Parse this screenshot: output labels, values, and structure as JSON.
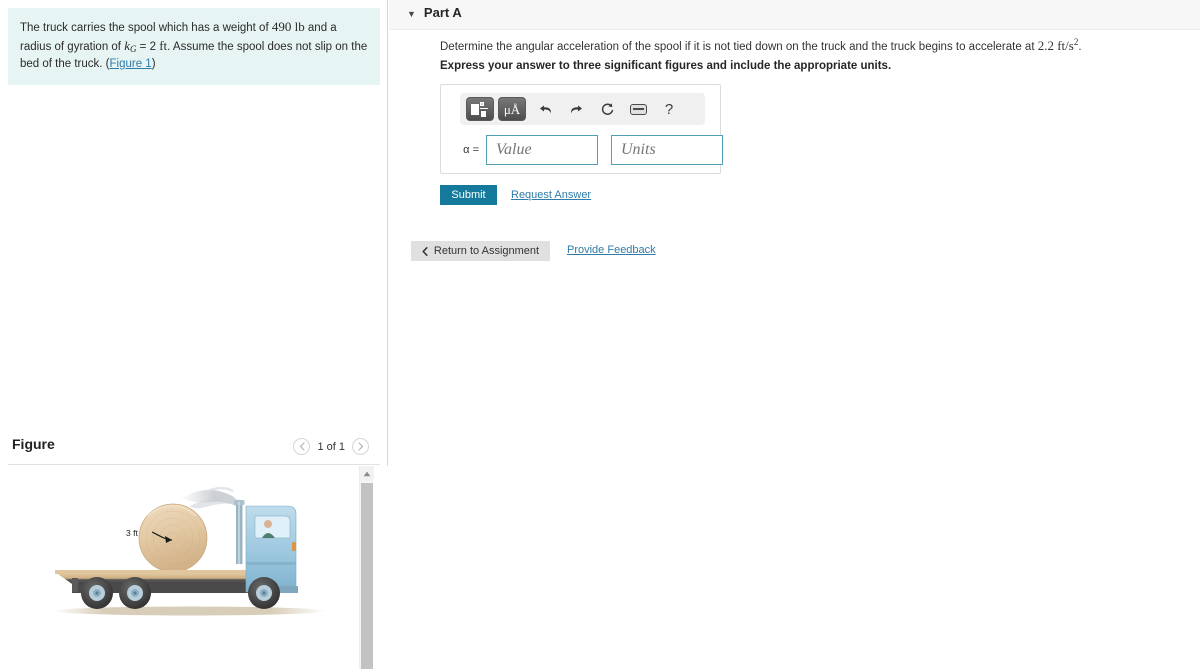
{
  "problem": {
    "text_1": "The truck carries the spool which has a weight of ",
    "weight": "490",
    "weight_unit": "lb",
    "text_2": " and a radius of gyration of ",
    "kg_symbol": "k",
    "kg_sub": "G",
    "kg_eq": " = 2 ",
    "kg_unit": "ft",
    "text_3": ". Assume the spool does not slip on the bed of the truck. (",
    "figure_link": "Figure 1",
    "text_4": ")"
  },
  "figure": {
    "title": "Figure",
    "pager_label": "1 of 1",
    "prev_icon": "chevron-left-icon",
    "next_icon": "chevron-right-icon",
    "radius_label": "3 ft",
    "scroll_up_icon": "caret-up-icon"
  },
  "part": {
    "caret_icon": "caret-down-icon",
    "title": "Part A",
    "question_pre": "Determine the angular acceleration of the spool if it is not tied down on the truck and the truck begins to accelerate at ",
    "question_value": "2.2",
    "question_unit": "ft/s",
    "question_exp": "2",
    "question_post": ".",
    "express": "Express your answer to three significant figures and include the appropriate units."
  },
  "answer": {
    "variable": "α =",
    "value_placeholder": "Value",
    "units_placeholder": "Units",
    "toolbar": {
      "template_icon": "math-template-icon",
      "units_label": "μÅ",
      "undo_icon": "undo-icon",
      "redo_icon": "redo-icon",
      "reset_icon": "reset-icon",
      "keyboard_icon": "keyboard-icon",
      "help_label": "?"
    }
  },
  "actions": {
    "submit_label": "Submit",
    "request_answer_label": "Request Answer",
    "return_label": "Return to Assignment",
    "return_icon": "chevron-left-icon",
    "feedback_label": "Provide Feedback"
  },
  "colors": {
    "problem_bg": "#e6f4f3",
    "submit_bg": "#15799b",
    "link": "#2f7ca8",
    "input_border": "#4f9fb5",
    "truck_body": "#a8cfe3",
    "spool": "#e3c9a4"
  }
}
